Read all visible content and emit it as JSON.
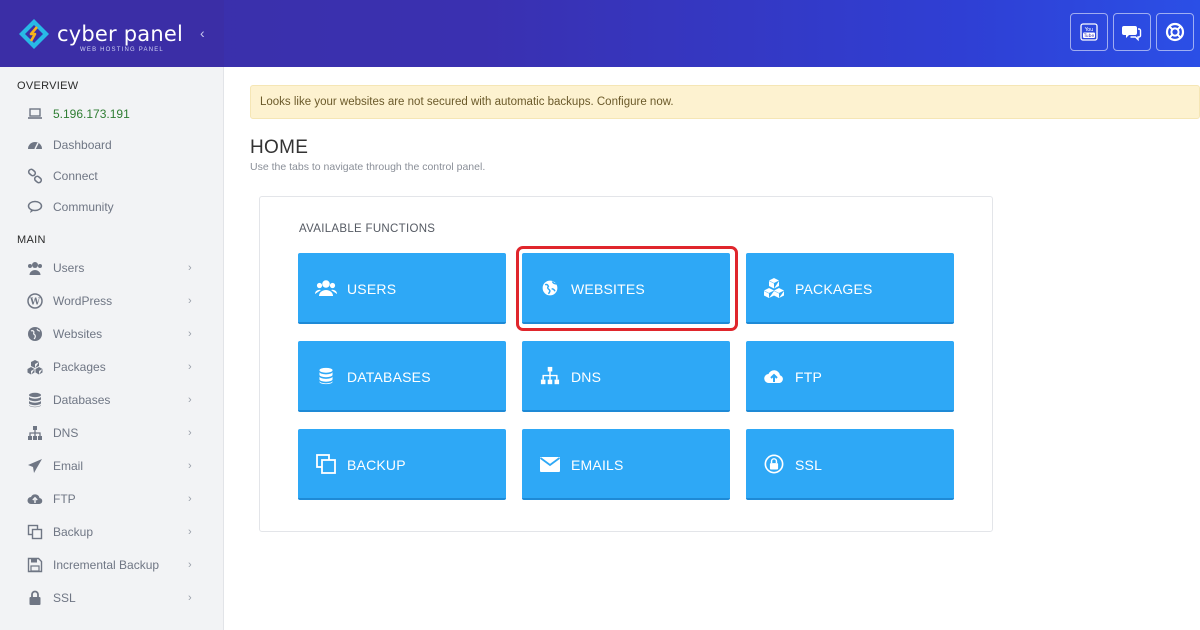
{
  "brand": {
    "name": "cyber panel",
    "tagline": "WEB HOSTING PANEL"
  },
  "header": {
    "buttons": [
      {
        "icon": "youtube-icon"
      },
      {
        "icon": "chat-icon"
      },
      {
        "icon": "support-icon"
      }
    ]
  },
  "sidebar": {
    "overview_title": "OVERVIEW",
    "main_title": "MAIN",
    "overview_items": [
      {
        "label": "5.196.173.191",
        "icon": "laptop-icon"
      },
      {
        "label": "Dashboard",
        "icon": "dashboard-icon"
      },
      {
        "label": "Connect",
        "icon": "link-icon"
      },
      {
        "label": "Community",
        "icon": "comments-icon"
      }
    ],
    "main_items": [
      {
        "label": "Users",
        "icon": "users-icon"
      },
      {
        "label": "WordPress",
        "icon": "wordpress-icon"
      },
      {
        "label": "Websites",
        "icon": "globe-icon"
      },
      {
        "label": "Packages",
        "icon": "cubes-icon"
      },
      {
        "label": "Databases",
        "icon": "database-icon"
      },
      {
        "label": "DNS",
        "icon": "sitemap-icon"
      },
      {
        "label": "Email",
        "icon": "paper-plane-icon"
      },
      {
        "label": "FTP",
        "icon": "cloud-upload-icon"
      },
      {
        "label": "Backup",
        "icon": "copy-icon"
      },
      {
        "label": "Incremental Backup",
        "icon": "save-icon"
      },
      {
        "label": "SSL",
        "icon": "lock-icon"
      }
    ],
    "chevron": "›"
  },
  "alert": {
    "text": "Looks like your websites are not secured with automatic backups. Configure now."
  },
  "page": {
    "title": "HOME",
    "subtitle": "Use the tabs to navigate through the control panel."
  },
  "functions": {
    "title": "AVAILABLE FUNCTIONS",
    "tiles": [
      {
        "label": "USERS",
        "icon": "users-icon"
      },
      {
        "label": "WEBSITES",
        "icon": "globe-icon"
      },
      {
        "label": "PACKAGES",
        "icon": "cubes-icon"
      },
      {
        "label": "DATABASES",
        "icon": "database-icon"
      },
      {
        "label": "DNS",
        "icon": "sitemap-icon"
      },
      {
        "label": "FTP",
        "icon": "cloud-upload-icon"
      },
      {
        "label": "BACKUP",
        "icon": "copy-icon"
      },
      {
        "label": "EMAILS",
        "icon": "envelope-icon"
      },
      {
        "label": "SSL",
        "icon": "lock-icon"
      }
    ]
  },
  "colors": {
    "tile": "#2ea8f6",
    "highlight": "#e0262c",
    "header": "#3a2fa8"
  }
}
